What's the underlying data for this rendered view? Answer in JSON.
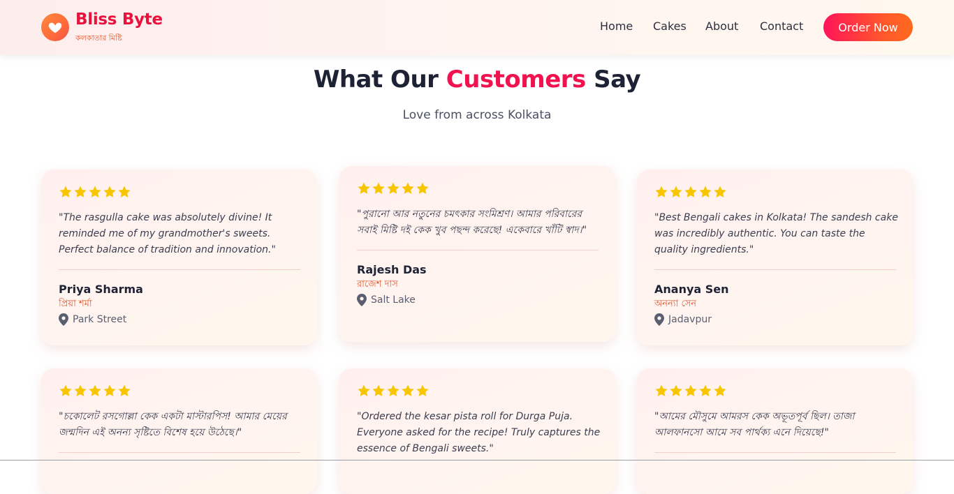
{
  "brand": {
    "name": "Bliss Byte",
    "tagline": "কলকাতার মিষ্টি",
    "icon": "heart-icon",
    "color": "#e8123c"
  },
  "nav": {
    "items": [
      {
        "label": "Home"
      },
      {
        "label": "Cakes"
      },
      {
        "label": "About"
      },
      {
        "label": "Contact"
      }
    ],
    "cta": "Order Now"
  },
  "section": {
    "title_pre": "What Our ",
    "title_accent": "Customers",
    "title_post": " Say",
    "subtitle": "Love from across Kolkata"
  },
  "colors": {
    "accent": "#f0134f",
    "star": "#f7c600",
    "bengali_name": "#e4572e"
  },
  "testimonials": [
    {
      "rating": 5,
      "quote": "\"The rasgulla cake was absolutely divine! It reminded me of my grandmother's sweets. Perfect balance of tradition and innovation.\"",
      "name": "Priya Sharma",
      "name_bn": "প্রিয়া শর্মা",
      "location": "Park Street"
    },
    {
      "rating": 5,
      "quote": "\"পুরানো আর নতুনের চমৎকার সংমিশ্রণ। আমার পরিবারের সবাই মিষ্টি দই কেক খুব পছন্দ করেছে! একেবারে খাঁটি স্বাদ।\"",
      "name": "Rajesh Das",
      "name_bn": "রাজেশ দাস",
      "location": "Salt Lake"
    },
    {
      "rating": 5,
      "quote": "\"Best Bengali cakes in Kolkata! The sandesh cake was incredibly authentic. You can taste the quality ingredients.\"",
      "name": "Ananya Sen",
      "name_bn": "অনন্যা সেন",
      "location": "Jadavpur"
    },
    {
      "rating": 5,
      "quote": "\"চকোলেট রসগোল্লা কেক একটা মাস্টারপিস! আমার মেয়ের জন্মদিন এই অনন্য সৃষ্টিতে বিশেষ হয়ে উঠেছে।\""
    },
    {
      "rating": 5,
      "quote": "\"Ordered the kesar pista roll for Durga Puja. Everyone asked for the recipe! Truly captures the essence of Bengali sweets.\""
    },
    {
      "rating": 5,
      "quote": "\"আমের মৌসুমে আমরস কেক অভূতপূর্ব ছিল। তাজা আলফানসো আমে সব পার্থক্য এনে দিয়েছে!\""
    }
  ]
}
